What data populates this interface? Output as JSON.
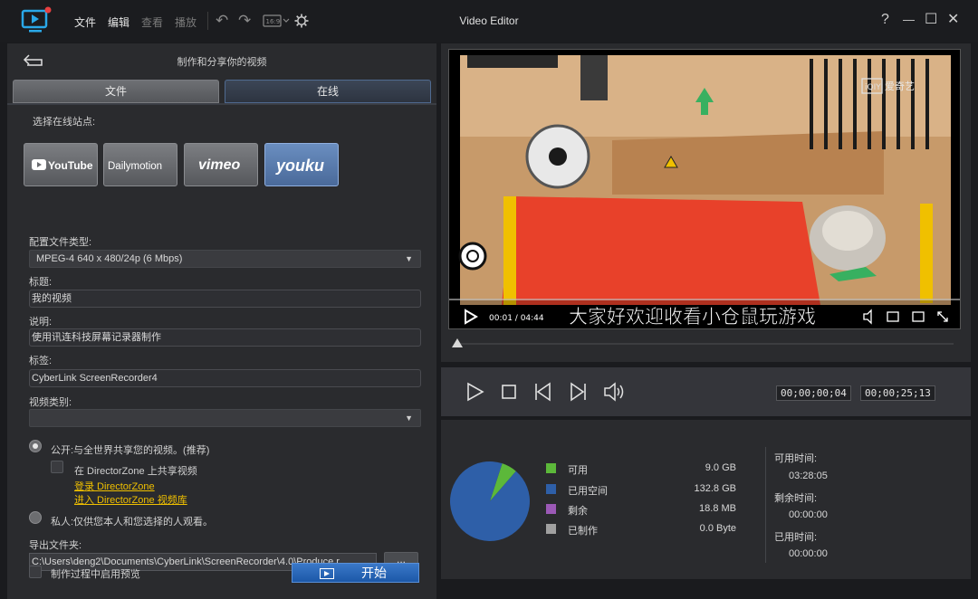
{
  "titlebar": {
    "menus": {
      "file": "文件",
      "edit": "编辑",
      "view": "查看",
      "play": "播放"
    },
    "title": "Video Editor",
    "help": "?",
    "minimize": "—",
    "maximize": "☐",
    "close": "✕"
  },
  "left": {
    "header": "制作和分享你的视频",
    "tabs": {
      "file": "文件",
      "online": "在线"
    },
    "site_label": "选择在线站点:",
    "sites": {
      "youtube": "YouTube",
      "dailymotion": "Dailymotion",
      "vimeo": "vimeo",
      "youku": "youku"
    },
    "profile_label": "配置文件类型:",
    "profile_value": "MPEG-4 640 x 480/24p (6 Mbps)",
    "title_label": "标题:",
    "title_value": "我的视频",
    "desc_label": "说明:",
    "desc_value": "使用讯连科技屏幕记录器制作",
    "tags_label": "标签:",
    "tags_value": "CyberLink ScreenRecorder4",
    "category_label": "视频类别:",
    "category_value": "",
    "public_label": "公开:与全世界共享您的视频。(推荐)",
    "directorzone_label": "在 DirectorZone 上共享视频",
    "login_link": "登录 DirectorZone",
    "library_link": "进入 DirectorZone 视频库",
    "private_label": "私人:仅供您本人和您选择的人观看。",
    "export_label": "导出文件夹:",
    "export_path": "C:\\Users\\deng2\\Documents\\CyberLink\\ScreenRecorder\\4.0\\Produce.r",
    "browse_label": "...",
    "preview_label": "制作过程中启用预览",
    "start_label": "开始"
  },
  "video": {
    "watermark": "爱奇艺",
    "time": "00:01 / 04:44",
    "subtitle": "大家好欢迎收看小仓鼠玩游戏",
    "progress": 0.0,
    "timecode_current": "00;00;00;04",
    "timecode_total": "00;00;25;13"
  },
  "disk": {
    "chart_data": {
      "type": "pie",
      "series": [
        {
          "name": "可用",
          "value": 9.0,
          "unit": "GB",
          "color": "#5cb83a"
        },
        {
          "name": "已用空间",
          "value": 132.8,
          "unit": "GB",
          "color": "#2e5fa8"
        },
        {
          "name": "剩余",
          "value": 18.8,
          "unit": "MB",
          "color": "#9b59b6"
        },
        {
          "name": "已制作",
          "value": 0.0,
          "unit": "Byte",
          "color": "#a0a0a0"
        }
      ]
    },
    "legend": [
      {
        "label": "可用",
        "value": "9.0  GB",
        "color": "#5cb83a"
      },
      {
        "label": "已用空间",
        "value": "132.8  GB",
        "color": "#2e5fa8"
      },
      {
        "label": "剩余",
        "value": "18.8  MB",
        "color": "#9b59b6"
      },
      {
        "label": "已制作",
        "value": "0.0  Byte",
        "color": "#a0a0a0"
      }
    ],
    "available_time_label": "可用时间:",
    "available_time": "03:28:05",
    "remaining_time_label": "剩余时间:",
    "remaining_time": "00:00:00",
    "used_time_label": "已用时间:",
    "used_time": "00:00:00"
  }
}
